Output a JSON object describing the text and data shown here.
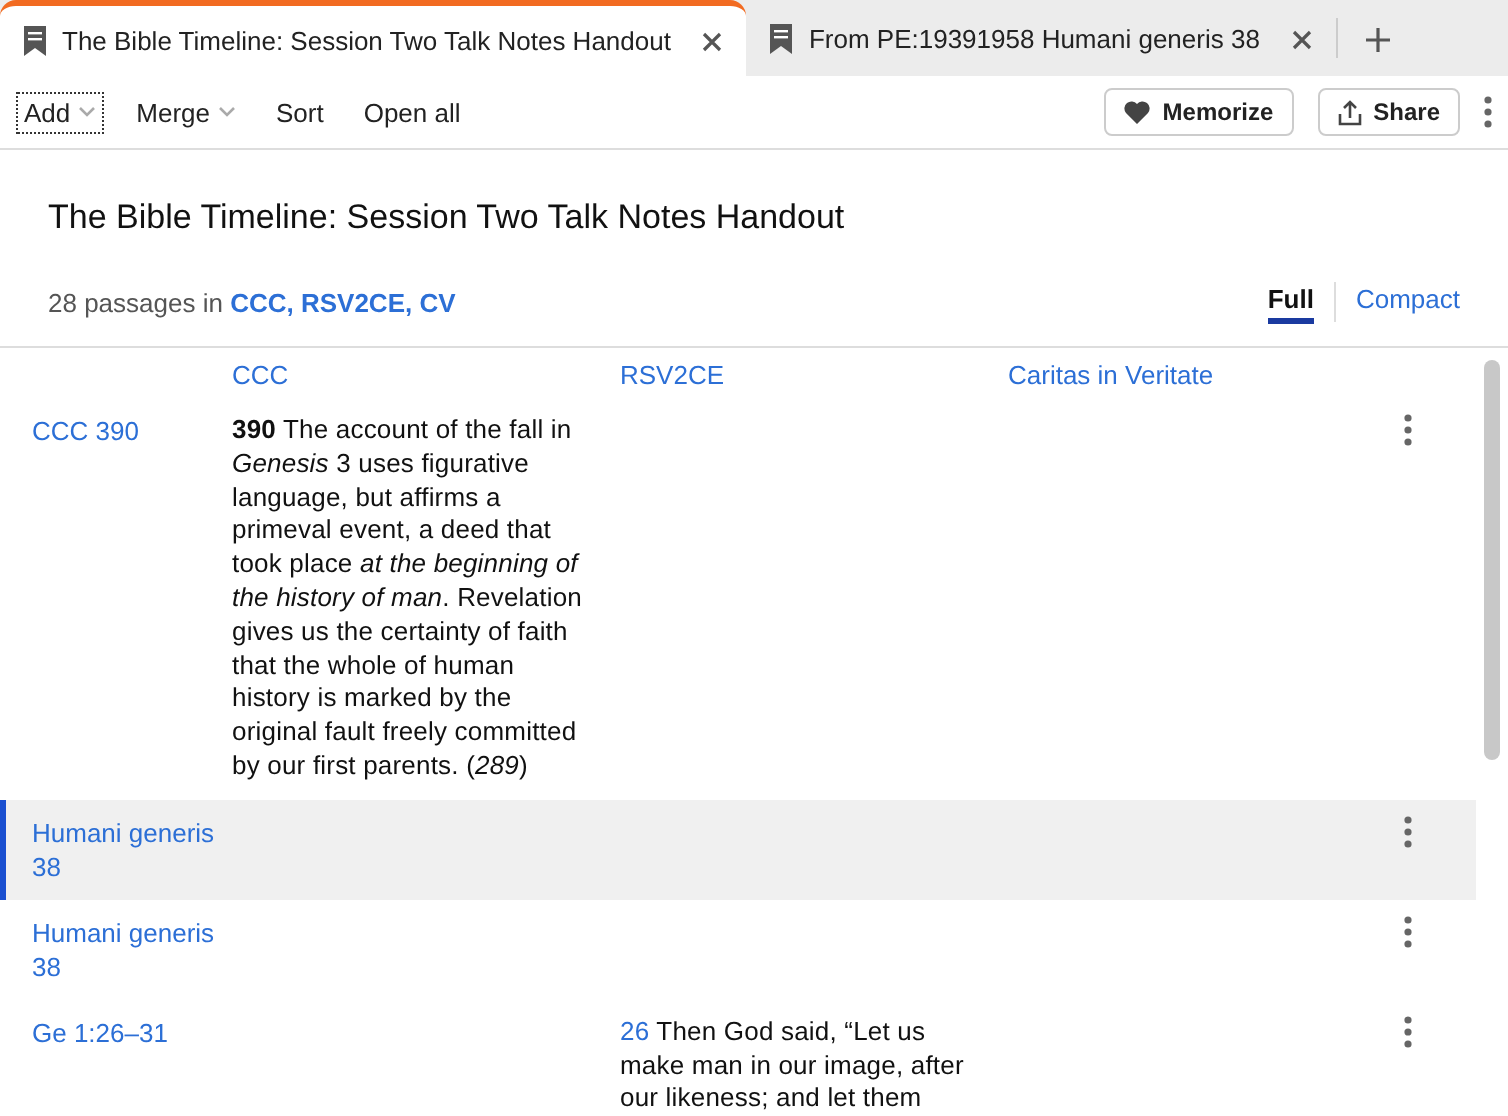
{
  "tabs": [
    {
      "label": "The Bible Timeline: Session Two Talk Notes Handout",
      "selected": true
    },
    {
      "label": "From PE:19391958 Humani generis 38",
      "selected": false
    }
  ],
  "toolbar": {
    "left": [
      {
        "label": "Add",
        "dropdown": true
      },
      {
        "label": "Merge",
        "dropdown": true
      },
      {
        "label": "Sort",
        "dropdown": false
      },
      {
        "label": "Open all",
        "dropdown": false
      }
    ],
    "memorize": "Memorize",
    "share": "Share"
  },
  "title": "The Bible Timeline: Session Two Talk Notes Handout",
  "summary": {
    "prefix": "28 passages in",
    "sources": "CCC, RSV2CE, CV"
  },
  "views": [
    {
      "label": "Full",
      "selected": true
    },
    {
      "label": "Compact",
      "selected": false
    }
  ],
  "columns": [
    "CCC",
    "RSV2CE",
    "Caritas in Veritate"
  ],
  "rows": [
    {
      "reference": "CCC 390",
      "selected": false,
      "cells": [
        {
          "text": "**390** The account of the fall in *Genesis* 3 uses figurative language, but affirms a primeval event, a deed that took place *at the beginning of the history of man*. Revelation gives us the certainty of faith that the whole of human history is marked by the original fault freely committed by our first parents. (*289*)"
        },
        null,
        null
      ]
    },
    {
      "reference": "Humani generis 38",
      "selected": true,
      "cells": [
        null,
        null,
        null
      ]
    },
    {
      "reference": "Humani generis 38",
      "selected": false,
      "cells": [
        null,
        null,
        null
      ]
    },
    {
      "reference": "Ge 1:26–31",
      "selected": false,
      "cells": [
        null,
        {
          "verse": "26",
          "text": "Then God said, “Let us make man in our image, after our likeness; and let them"
        },
        null
      ]
    }
  ]
}
